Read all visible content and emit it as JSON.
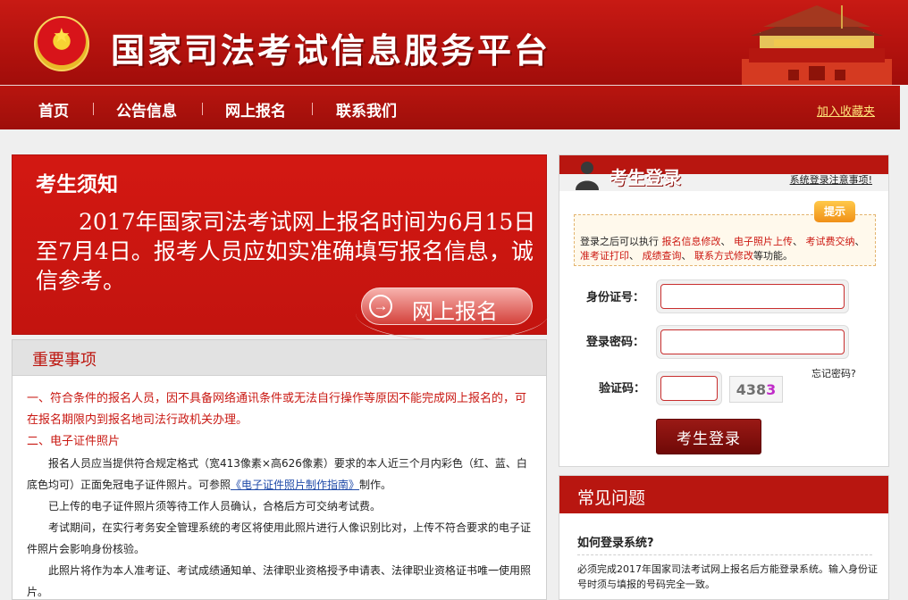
{
  "header": {
    "site_title": "国家司法考试信息服务平台"
  },
  "nav": {
    "items": [
      "首页",
      "公告信息",
      "网上报名",
      "联系我们"
    ],
    "favorite_link": "加入收藏夹"
  },
  "notice": {
    "title": "考生须知",
    "body": "2017年国家司法考试网上报名时间为6月15日至7月4日。报考人员应如实准确填写报名信息，诚信参考。",
    "signup_button": "网上报名",
    "signup_icon": "arrow-right-icon"
  },
  "important": {
    "title": "重要事项",
    "item1": "一、符合条件的报名人员，因不具备网络通讯条件或无法自行操作等原因不能完成网上报名的，可在报名期限内到报名地司法行政机关办理。",
    "item2_title": "二、电子证件照片",
    "para1_before_link": "报名人员应当提供符合规定格式（宽413像素×高626像素）要求的本人近三个月内彩色（红、蓝、白底色均可）正面免冠电子证件照片。可参照",
    "para1_link": "《电子证件照片制作指南》",
    "para1_after_link": "制作。",
    "para2": "已上传的电子证件照片须等待工作人员确认，合格后方可交纳考试费。",
    "para3": "考试期间，在实行考务安全管理系统的考区将使用此照片进行人像识别比对，上传不符合要求的电子证件照片会影响身份核验。",
    "para4": "此照片将作为本人准考证、考试成绩通知单、法律职业资格授予申请表、法律职业资格证书唯一使用照片。"
  },
  "login": {
    "title": "考生登录",
    "note_link": "系统登录注意事项!",
    "tip_badge": "提示",
    "tip_prefix": "登录之后可以执行",
    "tip_actions": [
      "报名信息修改",
      "电子照片上传",
      "考试费交纳",
      "准考证打印",
      "成绩查询",
      "联系方式修改"
    ],
    "tip_suffix": "等功能。",
    "id_label": "身份证号：",
    "id_value": "",
    "password_label": "登录密码：",
    "password_value": "",
    "forgot_link": "忘记密码?",
    "captcha_label": "验证码：",
    "captcha_value": "",
    "captcha_code_main": "438",
    "captcha_code_last": "3",
    "login_button": "考生登录"
  },
  "faq": {
    "title": "常见问题",
    "question": "如何登录系统?",
    "answer": "必须完成2017年国家司法考试网上报名后方能登录系统。输入身份证号时须与填报的号码完全一致。"
  }
}
